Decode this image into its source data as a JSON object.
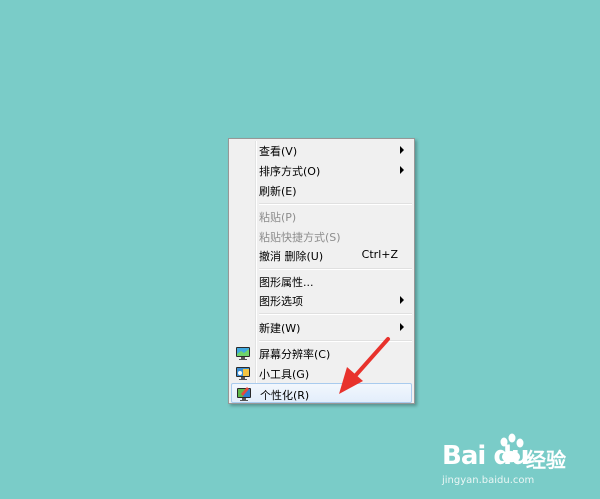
{
  "context_menu": {
    "items": [
      {
        "label": "查看(V)",
        "shortcut": "",
        "submenu": true,
        "disabled": false
      },
      {
        "label": "排序方式(O)",
        "shortcut": "",
        "submenu": true,
        "disabled": false
      },
      {
        "label": "刷新(E)",
        "shortcut": "",
        "submenu": false,
        "disabled": false
      },
      {
        "label": "粘贴(P)",
        "shortcut": "",
        "submenu": false,
        "disabled": true
      },
      {
        "label": "粘贴快捷方式(S)",
        "shortcut": "",
        "submenu": false,
        "disabled": true
      },
      {
        "label": "撤消 删除(U)",
        "shortcut": "Ctrl+Z",
        "submenu": false,
        "disabled": false
      },
      {
        "label": "图形属性...",
        "shortcut": "",
        "submenu": false,
        "disabled": false
      },
      {
        "label": "图形选项",
        "shortcut": "",
        "submenu": true,
        "disabled": false
      },
      {
        "label": "新建(W)",
        "shortcut": "",
        "submenu": true,
        "disabled": false
      },
      {
        "label": "屏幕分辨率(C)",
        "shortcut": "",
        "submenu": false,
        "disabled": false,
        "icon": "monitor-icon"
      },
      {
        "label": "小工具(G)",
        "shortcut": "",
        "submenu": false,
        "disabled": false,
        "icon": "gadget-icon"
      },
      {
        "label": "个性化(R)",
        "shortcut": "",
        "submenu": false,
        "disabled": false,
        "icon": "personalize-icon",
        "highlighted": true
      }
    ]
  },
  "colors": {
    "desktop_background": "#7accc8",
    "arrow": "#e8322c"
  },
  "watermark": {
    "logo": "Bai du",
    "brand": "经验",
    "url": "jingyan.baidu.com"
  }
}
